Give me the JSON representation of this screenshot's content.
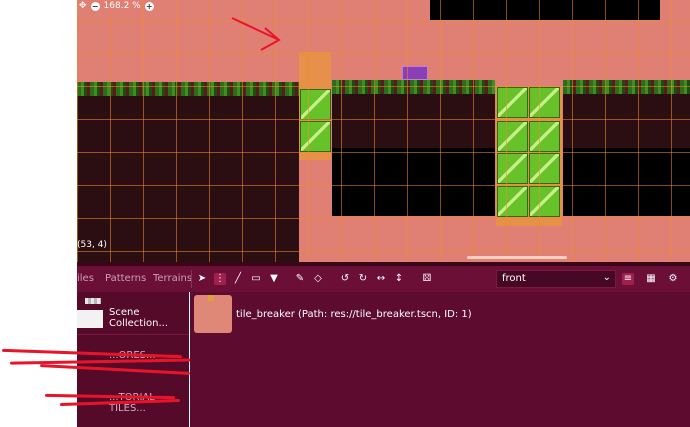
{
  "viewport": {
    "zoom_label": "168.2 %",
    "coord_readout": "(53, 4)"
  },
  "toolbar": {
    "tabs": [
      {
        "label": "iles"
      },
      {
        "label": "Patterns"
      },
      {
        "label": "Terrains"
      }
    ],
    "layer_select": "front"
  },
  "scene_list": {
    "items": [
      {
        "label": "Scene Collection..."
      },
      {
        "label": "...ORES..."
      },
      {
        "label": "...TORIAL TILES..."
      }
    ]
  },
  "scene_detail": {
    "label": "tile_breaker (Path: res://tile_breaker.tscn, ID: 1)"
  },
  "colors": {
    "viewport_bg": "#e07f74",
    "panel_bg": "#560a2a",
    "toolbar_bg": "#6b0f36",
    "accent": "#e8142a"
  }
}
